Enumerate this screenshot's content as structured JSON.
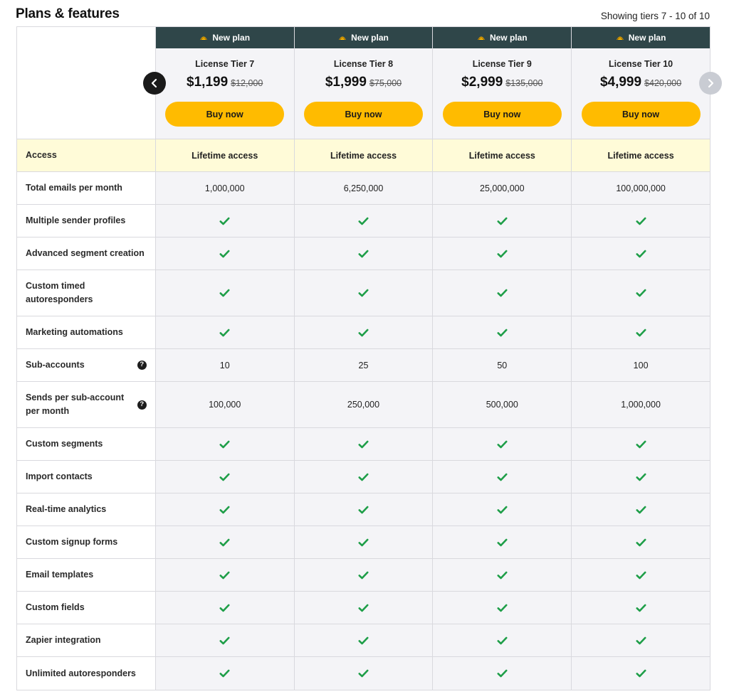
{
  "page": {
    "title": "Plans & features",
    "tier_count": "Showing tiers 7 - 10 of 10"
  },
  "plans": [
    {
      "banner": "New plan",
      "name": "License Tier 7",
      "price": "$1,199",
      "old_price": "$12,000",
      "button": "Buy now"
    },
    {
      "banner": "New plan",
      "name": "License Tier 8",
      "price": "$1,999",
      "old_price": "$75,000",
      "button": "Buy now"
    },
    {
      "banner": "New plan",
      "name": "License Tier 9",
      "price": "$2,999",
      "old_price": "$135,000",
      "button": "Buy now"
    },
    {
      "banner": "New plan",
      "name": "License Tier 10",
      "price": "$4,999",
      "old_price": "$420,000",
      "button": "Buy now"
    }
  ],
  "rows": [
    {
      "label": "Access",
      "values": [
        "Lifetime access",
        "Lifetime access",
        "Lifetime access",
        "Lifetime access"
      ]
    },
    {
      "label": "Total emails per month",
      "values": [
        "1,000,000",
        "6,250,000",
        "25,000,000",
        "100,000,000"
      ]
    },
    {
      "label": "Multiple sender profiles"
    },
    {
      "label": "Advanced segment creation"
    },
    {
      "label": "Custom timed autoresponders"
    },
    {
      "label": "Marketing automations"
    },
    {
      "label": "Sub-accounts",
      "help": "?",
      "values": [
        "10",
        "25",
        "50",
        "100"
      ]
    },
    {
      "label": "Sends per sub-account per month",
      "help": "?",
      "values": [
        "100,000",
        "250,000",
        "500,000",
        "1,000,000"
      ]
    },
    {
      "label": "Custom segments"
    },
    {
      "label": "Import contacts"
    },
    {
      "label": "Real-time analytics"
    },
    {
      "label": "Custom signup forms"
    },
    {
      "label": "Email templates"
    },
    {
      "label": "Custom fields"
    },
    {
      "label": "Zapier integration"
    },
    {
      "label": "Unlimited autoresponders"
    }
  ],
  "colors": {
    "banner": "#2f4649",
    "button": "#ffbb00",
    "check": "#1e9e48",
    "access_row": "#fffbd8"
  },
  "icons": {
    "check": "check-icon",
    "help": "help-icon",
    "prev": "chevron-left-icon",
    "next": "chevron-right-icon",
    "banner": "taco-icon"
  }
}
